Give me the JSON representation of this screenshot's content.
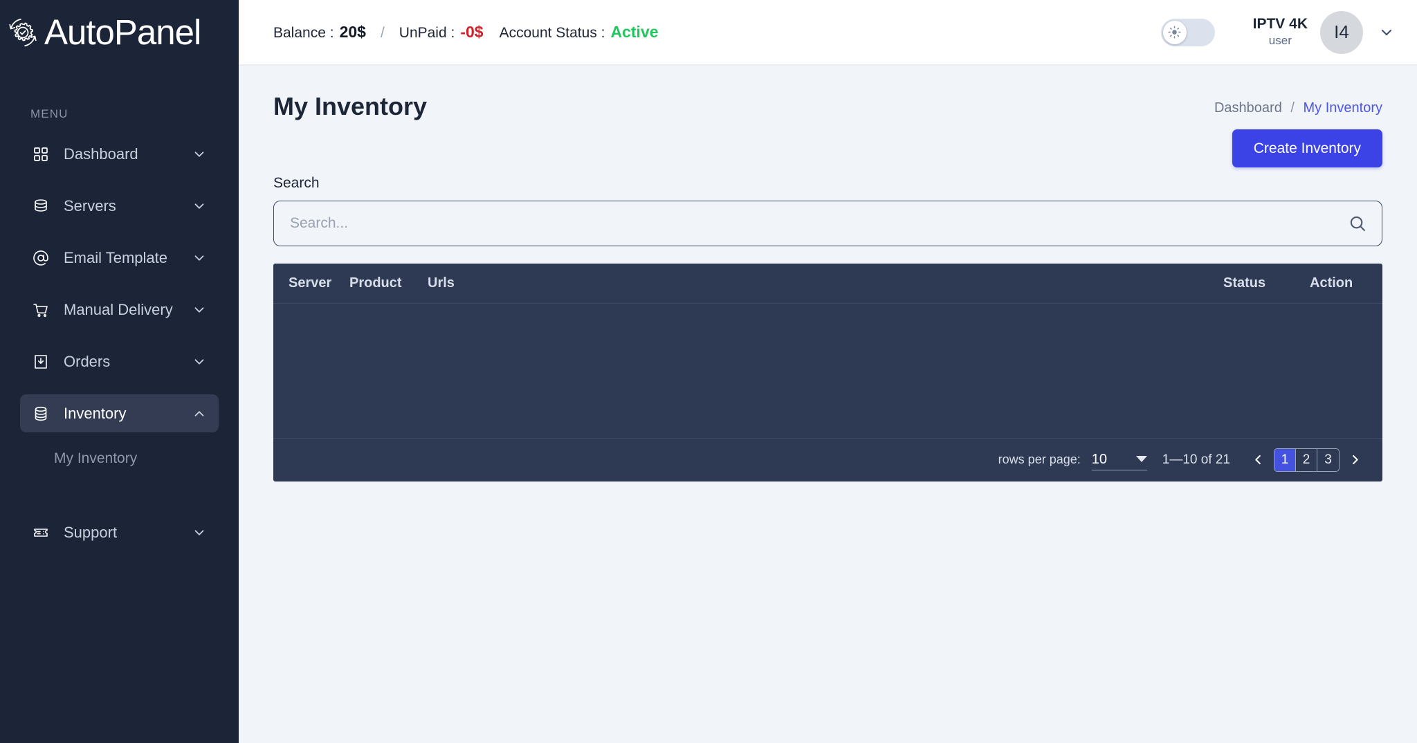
{
  "brand": {
    "name": "AutoPanel",
    "logo_icon": "gear-check-refresh-icon"
  },
  "sidebar": {
    "section_label": "MENU",
    "items": [
      {
        "label": "Dashboard",
        "icon": "grid-icon",
        "chevron": "chevron-down-icon",
        "active": false
      },
      {
        "label": "Servers",
        "icon": "server-stack-icon",
        "chevron": "chevron-down-icon",
        "active": false
      },
      {
        "label": "Email Template",
        "icon": "at-sign-icon",
        "chevron": "chevron-down-icon",
        "active": false
      },
      {
        "label": "Manual Delivery",
        "icon": "shopping-cart-icon",
        "chevron": "chevron-down-icon",
        "active": false
      },
      {
        "label": "Orders",
        "icon": "download-box-icon",
        "chevron": "chevron-down-icon",
        "active": false
      },
      {
        "label": "Inventory",
        "icon": "database-icon",
        "chevron": "chevron-up-icon",
        "active": true
      },
      {
        "label": "Support",
        "icon": "ticket-icon",
        "chevron": "chevron-down-icon",
        "active": false
      }
    ],
    "sub_items": [
      {
        "label": "My Inventory",
        "parent": "Inventory"
      }
    ]
  },
  "topbar": {
    "balance_label": "Balance :",
    "balance_value": "20$",
    "separator": "/",
    "unpaid_label": "UnPaid :",
    "unpaid_value": "-0$",
    "status_label": "Account Status :",
    "status_value": "Active",
    "theme_toggle_icon": "sun-icon",
    "user_name": "IPTV 4K",
    "user_role": "user",
    "avatar_initials": "I4",
    "user_chevron_icon": "chevron-down-icon",
    "colors": {
      "unpaid": "#d32029",
      "status": "#22c55e",
      "accent": "#3b43e6"
    }
  },
  "page": {
    "title": "My Inventory",
    "breadcrumb": {
      "parent": "Dashboard",
      "separator": "/",
      "current": "My Inventory"
    },
    "create_button": "Create Inventory"
  },
  "search": {
    "label": "Search",
    "placeholder": "Search...",
    "value": "",
    "icon": "search-icon"
  },
  "table": {
    "columns": [
      "Server",
      "Product",
      "Urls",
      "Status",
      "Action"
    ],
    "rows": [],
    "pagination": {
      "rows_per_page_label": "rows per page:",
      "rows_per_page_value": "10",
      "range_text": "1—10 of 21",
      "prev_icon": "chevron-left-icon",
      "next_icon": "chevron-right-icon",
      "pages": [
        "1",
        "2",
        "3"
      ],
      "active_page": "1"
    }
  }
}
